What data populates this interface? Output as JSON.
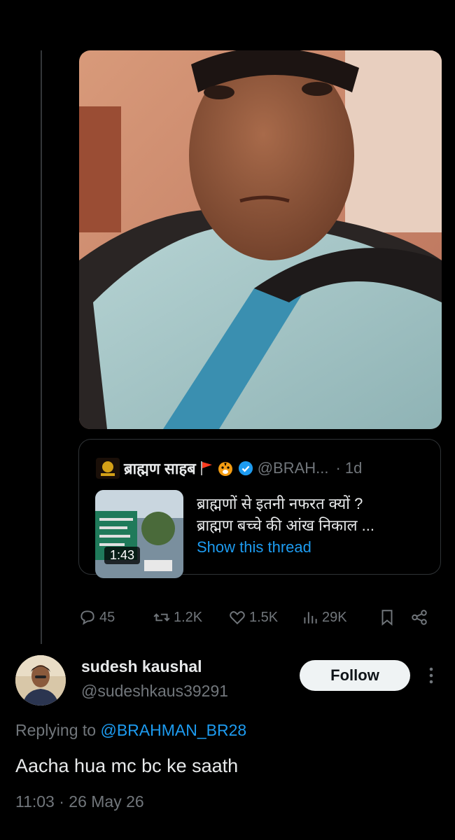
{
  "quoted_tweet": {
    "author_name": "ब्राह्मण साहब",
    "handle": "@BRAH...",
    "time": "1d",
    "separator": "·",
    "text_line1": "ब्राह्मणों से इतनी नफरत क्यों ?",
    "text_line2": "ब्राह्मण बच्चे की आंख निकाल ...",
    "show_thread": "Show this thread",
    "video_duration": "1:43"
  },
  "actions": {
    "replies": "45",
    "retweets": "1.2K",
    "likes": "1.5K",
    "views": "29K"
  },
  "reply": {
    "name": "sudesh kaushal",
    "handle": "@sudeshkaus39291",
    "follow_label": "Follow",
    "replying_prefix": "Replying to",
    "replying_to": "@BRAHMAN_BR28",
    "text": "Aacha hua mc bc ke saath",
    "timestamp": "11:03 · 26 May 26"
  },
  "colors": {
    "background": "#000000",
    "link": "#1d9bf0",
    "muted": "#71767b",
    "verified": "#1d9bf0"
  }
}
